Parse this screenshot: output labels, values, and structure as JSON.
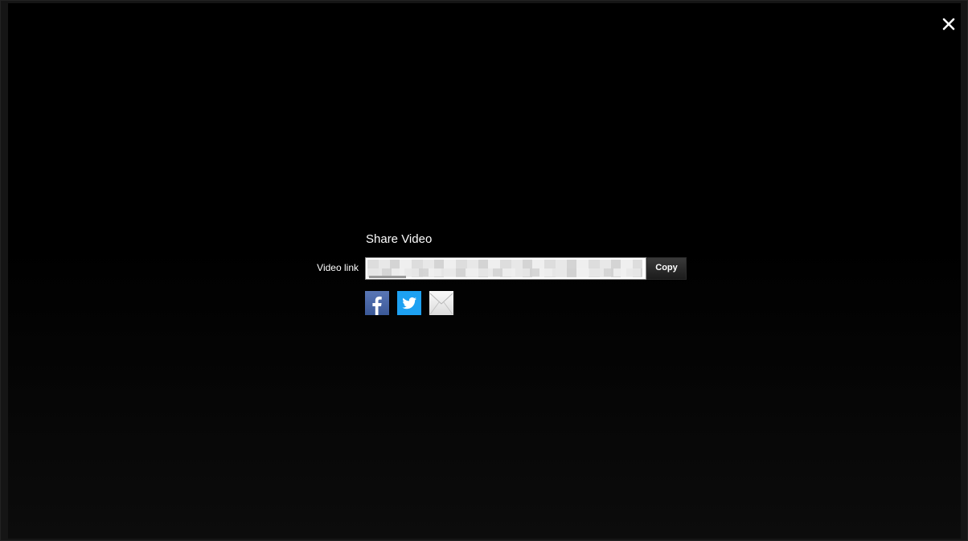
{
  "dialog": {
    "title": "Share Video",
    "link_label": "Video link",
    "link_value": "",
    "copy_label": "Copy"
  },
  "social": [
    {
      "name": "facebook-icon",
      "color": "#3b5998"
    },
    {
      "name": "twitter-icon",
      "color": "#1da1f2"
    },
    {
      "name": "email-icon",
      "color": "#eeeeee"
    }
  ],
  "close": {
    "icon": "close-icon",
    "color": "#ffffff"
  }
}
